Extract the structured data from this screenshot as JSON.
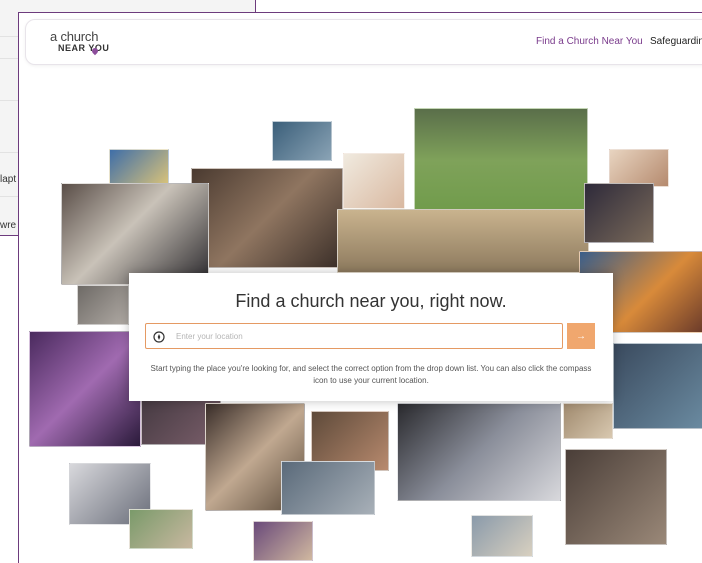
{
  "background_window": {
    "snippet_1": "lapt",
    "snippet_2": "wre"
  },
  "header": {
    "logo_line1": "a church",
    "logo_line2": "NEAR YOU",
    "nav": [
      {
        "label": "Find a Church Near You"
      },
      {
        "label": "Safeguarding"
      }
    ]
  },
  "search": {
    "heading": "Find a church near you, right now.",
    "placeholder": "Enter your location",
    "button_label": "→",
    "help_text": "Start typing the place you're looking for, and select the correct option from the drop down list. You can also click the compass icon to use your current location."
  },
  "icons": {
    "compass": "compass-icon",
    "arrow": "arrow-right-icon",
    "logo_pin": "location-pin-icon"
  },
  "colors": {
    "brand_purple": "#7a3b8c",
    "accent_orange": "#f0a76e",
    "input_border": "#e59a63"
  }
}
